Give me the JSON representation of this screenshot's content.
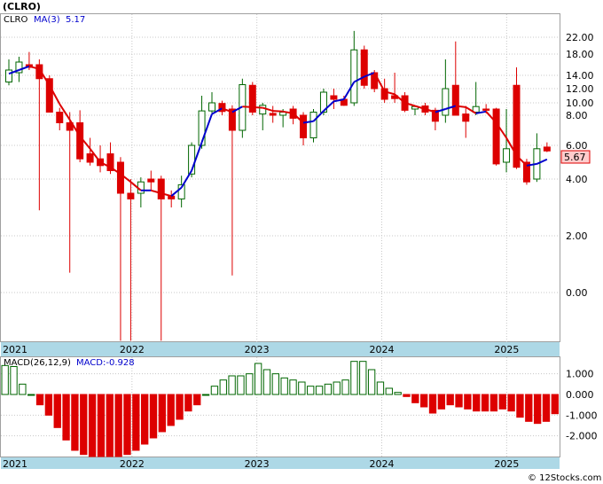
{
  "chart_data": [
    {
      "type": "candlestick",
      "title": "(CLRO)",
      "legend": [
        {
          "label": "CLRO",
          "color": "#000000"
        },
        {
          "label": "MA(3)",
          "color": "#0000cc"
        },
        {
          "label": "5.17",
          "color": "#0000cc"
        }
      ],
      "last_price_label": "5.67",
      "y_scale": "log-shifted",
      "y_ticks": [
        "22.00",
        "18.00",
        "14.00",
        "12.00",
        "10.00",
        "8.00",
        "6.00",
        "4.00",
        "2.00",
        "0.00"
      ],
      "x_tick_labels": [
        "2021",
        "2022",
        "2023",
        "2024",
        "2025"
      ],
      "colors": {
        "up": "#ffffff",
        "up_border": "#006600",
        "down": "#dd0000",
        "ma": "#0000cc",
        "ma_down": "#dd0000",
        "axis_band": "#add8e6",
        "grid": "#c8c8c8"
      },
      "candles": [
        {
          "o": 13.0,
          "h": 17.0,
          "l": 12.5,
          "c": 15.0
        },
        {
          "o": 14.5,
          "h": 17.5,
          "l": 13.0,
          "c": 16.5
        },
        {
          "o": 16.0,
          "h": 18.5,
          "l": 15.0,
          "c": 15.5
        },
        {
          "o": 16.0,
          "h": 17.0,
          "l": 2.9,
          "c": 13.5
        },
        {
          "o": 13.5,
          "h": 14.0,
          "l": 8.5,
          "c": 8.5
        },
        {
          "o": 8.5,
          "h": 9.2,
          "l": 7.0,
          "c": 7.5
        },
        {
          "o": 7.5,
          "h": 8.5,
          "l": 0.7,
          "c": 7.0
        },
        {
          "o": 7.5,
          "h": 8.8,
          "l": 5.0,
          "c": 5.2
        },
        {
          "o": 5.5,
          "h": 6.5,
          "l": 4.8,
          "c": 5.0
        },
        {
          "o": 5.2,
          "h": 6.0,
          "l": 4.4,
          "c": 4.8
        },
        {
          "o": 5.5,
          "h": 6.2,
          "l": 4.3,
          "c": 4.5
        },
        {
          "o": 5.0,
          "h": 5.3,
          "l": -1.7,
          "c": 3.5
        },
        {
          "o": 3.5,
          "h": 4.0,
          "l": -1.7,
          "c": 3.3
        },
        {
          "o": 3.5,
          "h": 4.1,
          "l": 3.0,
          "c": 3.9
        },
        {
          "o": 4.0,
          "h": 4.5,
          "l": 3.6,
          "c": 3.9
        },
        {
          "o": 4.0,
          "h": 4.2,
          "l": -1.7,
          "c": 3.3
        },
        {
          "o": 3.4,
          "h": 3.6,
          "l": 3.0,
          "c": 3.3
        },
        {
          "o": 3.3,
          "h": 4.2,
          "l": 3.0,
          "c": 3.8
        },
        {
          "o": 4.3,
          "h": 6.2,
          "l": 4.1,
          "c": 6.0
        },
        {
          "o": 6.0,
          "h": 11.0,
          "l": 5.8,
          "c": 8.7
        },
        {
          "o": 8.7,
          "h": 11.5,
          "l": 8.3,
          "c": 10.0
        },
        {
          "o": 9.9,
          "h": 10.3,
          "l": 8.0,
          "c": 8.6
        },
        {
          "o": 9.0,
          "h": 9.6,
          "l": 0.6,
          "c": 7.0
        },
        {
          "o": 7.0,
          "h": 13.5,
          "l": 6.5,
          "c": 12.6
        },
        {
          "o": 12.5,
          "h": 13.0,
          "l": 8.0,
          "c": 8.5
        },
        {
          "o": 8.2,
          "h": 10.0,
          "l": 7.0,
          "c": 9.6
        },
        {
          "o": 8.3,
          "h": 9.5,
          "l": 7.5,
          "c": 8.0
        },
        {
          "o": 8.0,
          "h": 9.0,
          "l": 7.2,
          "c": 8.5
        },
        {
          "o": 9.0,
          "h": 9.5,
          "l": 7.4,
          "c": 7.8
        },
        {
          "o": 8.0,
          "h": 8.5,
          "l": 6.0,
          "c": 6.5
        },
        {
          "o": 6.5,
          "h": 9.0,
          "l": 6.2,
          "c": 8.5
        },
        {
          "o": 8.5,
          "h": 12.0,
          "l": 8.0,
          "c": 11.5
        },
        {
          "o": 11.0,
          "h": 12.0,
          "l": 9.0,
          "c": 10.5
        },
        {
          "o": 10.5,
          "h": 11.0,
          "l": 9.5,
          "c": 9.6
        },
        {
          "o": 10.0,
          "h": 23.5,
          "l": 9.5,
          "c": 19.0
        },
        {
          "o": 19.0,
          "h": 20.0,
          "l": 12.0,
          "c": 12.5
        },
        {
          "o": 14.5,
          "h": 15.0,
          "l": 11.5,
          "c": 12.0
        },
        {
          "o": 12.0,
          "h": 13.5,
          "l": 10.0,
          "c": 10.5
        },
        {
          "o": 11.0,
          "h": 14.5,
          "l": 10.0,
          "c": 10.6
        },
        {
          "o": 11.0,
          "h": 11.5,
          "l": 8.5,
          "c": 8.8
        },
        {
          "o": 9.0,
          "h": 9.5,
          "l": 8.0,
          "c": 9.4
        },
        {
          "o": 9.5,
          "h": 10.0,
          "l": 8.0,
          "c": 8.5
        },
        {
          "o": 8.8,
          "h": 9.2,
          "l": 7.0,
          "c": 7.6
        },
        {
          "o": 8.0,
          "h": 17.0,
          "l": 7.5,
          "c": 12.0
        },
        {
          "o": 12.5,
          "h": 21.0,
          "l": 8.0,
          "c": 8.0
        },
        {
          "o": 8.2,
          "h": 9.5,
          "l": 6.5,
          "c": 7.6
        },
        {
          "o": 8.5,
          "h": 13.0,
          "l": 8.0,
          "c": 9.4
        },
        {
          "o": 9.0,
          "h": 9.8,
          "l": 8.3,
          "c": 8.8
        },
        {
          "o": 9.0,
          "h": 9.2,
          "l": 4.8,
          "c": 4.9
        },
        {
          "o": 5.0,
          "h": 9.0,
          "l": 4.4,
          "c": 5.8
        },
        {
          "o": 12.5,
          "h": 15.5,
          "l": 4.6,
          "c": 4.7
        },
        {
          "o": 5.0,
          "h": 5.2,
          "l": 3.8,
          "c": 3.9
        },
        {
          "o": 4.0,
          "h": 6.8,
          "l": 3.9,
          "c": 5.8
        },
        {
          "o": 5.9,
          "h": 6.2,
          "l": 5.6,
          "c": 5.67
        }
      ],
      "ma": [
        14.3,
        15.0,
        15.7,
        15.2,
        12.5,
        9.8,
        7.7,
        6.6,
        5.8,
        5.0,
        4.7,
        4.3,
        3.9,
        3.6,
        3.6,
        3.5,
        3.4,
        3.7,
        4.5,
        6.2,
        8.2,
        9.1,
        8.5,
        9.4,
        9.3,
        9.2,
        8.7,
        8.6,
        8.3,
        7.5,
        7.6,
        8.7,
        10.2,
        10.5,
        13.0,
        13.8,
        14.5,
        11.6,
        11.2,
        10.0,
        9.5,
        9.0,
        8.5,
        9.0,
        9.5,
        9.3,
        8.3,
        8.6,
        7.5,
        6.5,
        5.4,
        4.8,
        4.9,
        5.17
      ],
      "ma_colors": [
        "#0000cc",
        "#0000cc",
        "#0000cc",
        "#dd0000",
        "#dd0000",
        "#dd0000",
        "#dd0000",
        "#dd0000",
        "#dd0000",
        "#dd0000",
        "#dd0000",
        "#dd0000",
        "#dd0000",
        "#dd0000",
        "#0000cc",
        "#dd0000",
        "#dd0000",
        "#0000cc",
        "#0000cc",
        "#0000cc",
        "#0000cc",
        "#0000cc",
        "#dd0000",
        "#0000cc",
        "#dd0000",
        "#dd0000",
        "#dd0000",
        "#dd0000",
        "#dd0000",
        "#dd0000",
        "#0000cc",
        "#0000cc",
        "#0000cc",
        "#0000cc",
        "#0000cc",
        "#0000cc",
        "#0000cc",
        "#dd0000",
        "#dd0000",
        "#dd0000",
        "#dd0000",
        "#dd0000",
        "#dd0000",
        "#0000cc",
        "#0000cc",
        "#dd0000",
        "#dd0000",
        "#0000cc",
        "#dd0000",
        "#dd0000",
        "#dd0000",
        "#dd0000",
        "#0000cc",
        "#0000cc"
      ]
    },
    {
      "type": "bar",
      "legend_label": "MACD(26,12,9)",
      "value_label": "MACD:-0.928",
      "y_ticks": [
        "1.000",
        "0.000",
        "-1.000",
        "-2.000"
      ],
      "ylim": [
        -3.0,
        1.8
      ],
      "x_tick_labels": [
        "2021",
        "2022",
        "2023",
        "2024",
        "2025"
      ],
      "values": [
        1.4,
        1.35,
        0.5,
        0.0,
        -0.5,
        -1.0,
        -1.6,
        -2.2,
        -2.7,
        -2.9,
        -3.0,
        -3.0,
        -3.0,
        -3.0,
        -2.9,
        -2.7,
        -2.4,
        -2.1,
        -1.8,
        -1.5,
        -1.2,
        -0.8,
        -0.5,
        0.0,
        0.4,
        0.7,
        0.9,
        0.9,
        1.0,
        1.5,
        1.2,
        1.0,
        0.8,
        0.7,
        0.6,
        0.4,
        0.4,
        0.5,
        0.6,
        0.7,
        1.6,
        1.6,
        1.2,
        0.6,
        0.3,
        0.1,
        -0.1,
        -0.4,
        -0.6,
        -0.9,
        -0.7,
        -0.5,
        -0.6,
        -0.7,
        -0.8,
        -0.8,
        -0.8,
        -0.7,
        -0.8,
        -1.1,
        -1.3,
        -1.4,
        -1.3,
        -0.93
      ]
    }
  ],
  "footer": {
    "copyright": "© 12Stocks.com"
  }
}
